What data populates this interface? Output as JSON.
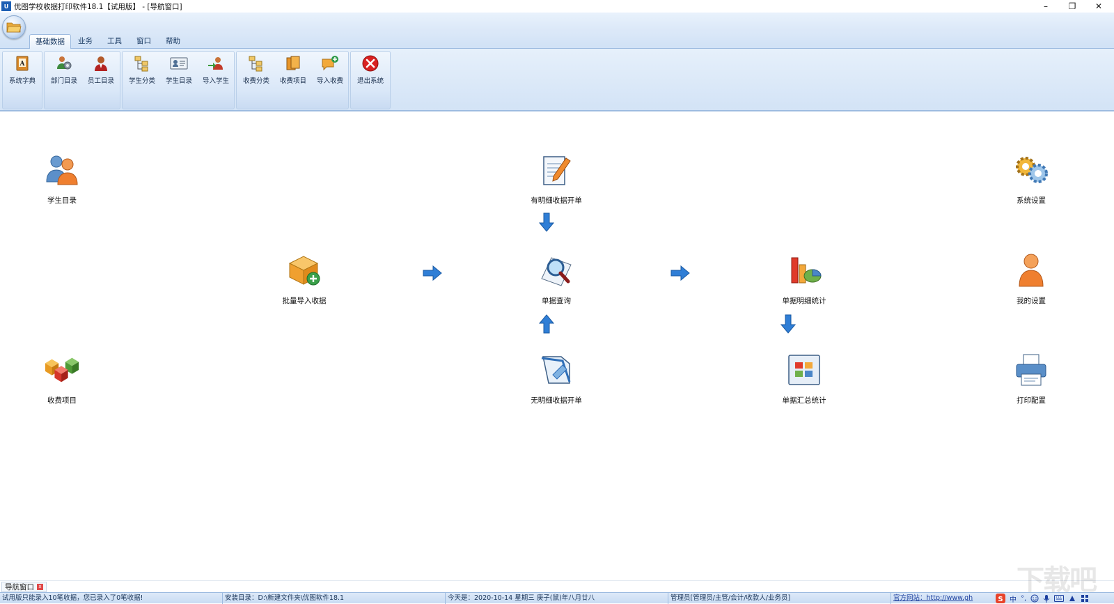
{
  "window": {
    "title": "优图学校收据打印软件18.1【试用版】 - [导航窗口]",
    "logo_text": "U",
    "controls": {
      "minimize": "–",
      "maximize": "❐",
      "close": "✕"
    }
  },
  "ribbon": {
    "tabs": [
      {
        "label": "基础数据",
        "active": true
      },
      {
        "label": "业务"
      },
      {
        "label": "工具"
      },
      {
        "label": "窗口"
      },
      {
        "label": "帮助"
      }
    ],
    "buttons": [
      {
        "label": "系统字典",
        "icon": "dictionary-book-icon"
      },
      {
        "label": "部门目录",
        "icon": "department-group-icon"
      },
      {
        "label": "员工目录",
        "icon": "employee-icon"
      },
      {
        "label": "学生分类",
        "icon": "tree-category-icon"
      },
      {
        "label": "学生目录",
        "icon": "id-card-icon"
      },
      {
        "label": "导入学生",
        "icon": "import-user-icon"
      },
      {
        "label": "收费分类",
        "icon": "tree-category-icon"
      },
      {
        "label": "收费项目",
        "icon": "documents-icon"
      },
      {
        "label": "导入收费",
        "icon": "import-message-icon"
      },
      {
        "label": "退出系统",
        "icon": "exit-icon"
      }
    ]
  },
  "navigation": {
    "items": [
      {
        "label": "学生目录",
        "icon": "users-icon"
      },
      {
        "label": "有明细收据开单",
        "icon": "document-edit-icon"
      },
      {
        "label": "系统设置",
        "icon": "gears-icon"
      },
      {
        "label": "批量导入收据",
        "icon": "box-add-icon"
      },
      {
        "label": "单据查询",
        "icon": "magnifier-icon"
      },
      {
        "label": "单据明细统计",
        "icon": "chart-icon"
      },
      {
        "label": "我的设置",
        "icon": "user-icon"
      },
      {
        "label": "收费项目",
        "icon": "cubes-icon"
      },
      {
        "label": "无明细收据开单",
        "icon": "scanner-icon"
      },
      {
        "label": "单据汇总统计",
        "icon": "summary-icon"
      },
      {
        "label": "打印配置",
        "icon": "printer-icon"
      }
    ]
  },
  "doc_tab": {
    "label": "导航窗口",
    "close": "x"
  },
  "status": {
    "trial_notice": "试用版只能录入10笔收据，您已录入了0笔收据!",
    "install_dir": "安装目录：D:\\新建文件夹\\优图软件18.1",
    "today": "今天是：2020-10-14 星期三 庚子(鼠)年八月廿八",
    "user": "管理员[管理员/主管/会计/收款人/业务员]",
    "site_label": "官方网站：",
    "site_url": "http://www.gh"
  },
  "tray": {
    "ime": "中",
    "punct": "°,"
  },
  "watermark": "下载吧"
}
